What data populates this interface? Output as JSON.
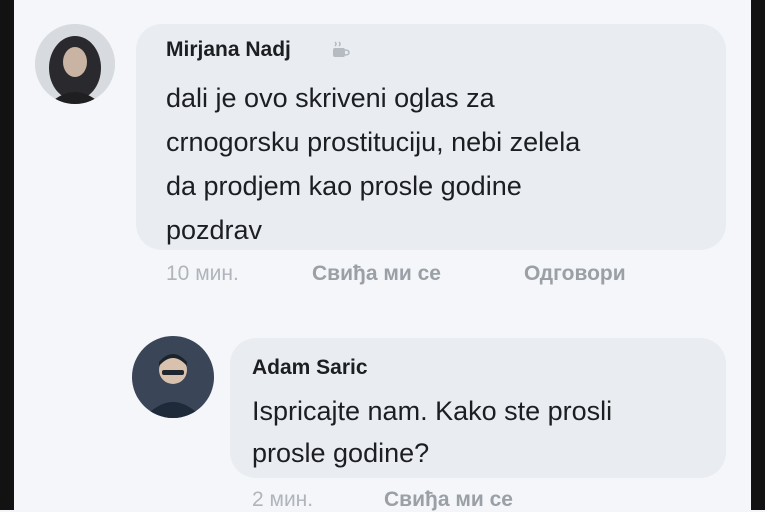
{
  "comments": [
    {
      "author": "Mirjana Nadj",
      "badge_icon": "coffee-cup-icon",
      "lines": [
        "dali je ovo skriveni oglas za",
        "crnogorsku prostituciju, nebi zelela",
        "da prodjem kao prosle godine",
        "pozdrav"
      ],
      "time": "10 мин.",
      "like_label": "Свиђа ми се",
      "reply_label": "Одговори"
    },
    {
      "author": "Adam Saric",
      "lines": [
        "Ispricajte nam. Kako ste prosli",
        "prosle godine?"
      ],
      "time": "2 мин.",
      "like_label": "Свиђа ми се"
    }
  ],
  "colors": {
    "bubble": "#e9ecf0",
    "text": "#1c1e21",
    "muted": "#9aa0a6",
    "frame": "#121212"
  }
}
